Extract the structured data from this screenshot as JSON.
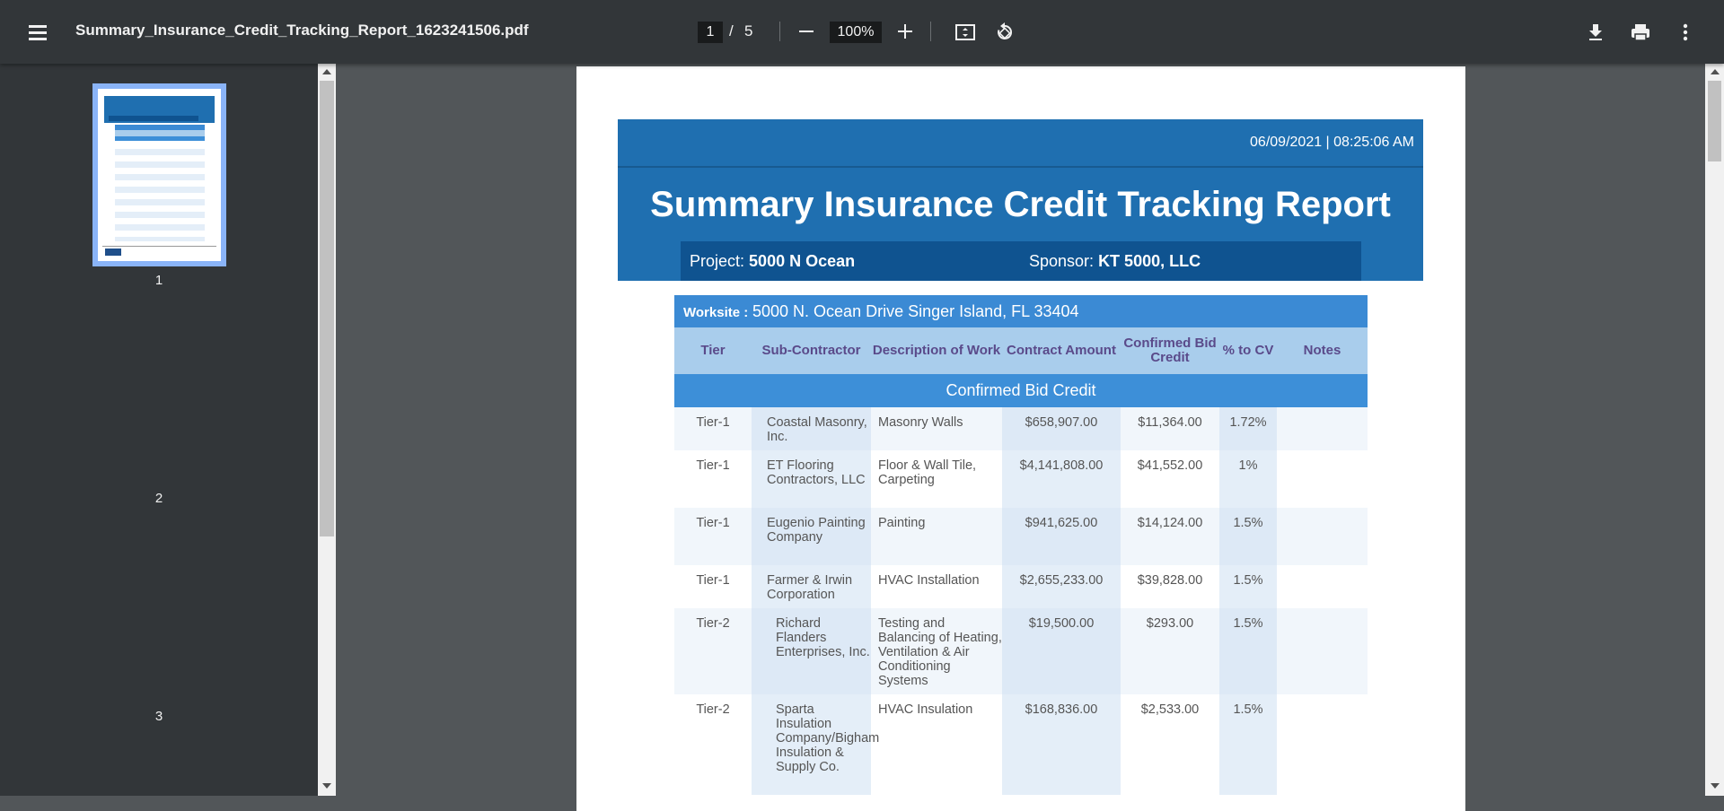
{
  "toolbar": {
    "file_name": "Summary_Insurance_Credit_Tracking_Report_1623241506.pdf",
    "current_page": "1",
    "page_separator": "/",
    "total_pages": "5",
    "zoom": "100%"
  },
  "sidebar": {
    "thumbnails": [
      {
        "label": "1"
      },
      {
        "label": "2"
      },
      {
        "label": "3"
      }
    ]
  },
  "report": {
    "timestamp": "06/09/2021 | 08:25:06 AM",
    "title": "Summary Insurance Credit Tracking Report",
    "project_label": "Project:",
    "project_value": "5000 N Ocean",
    "sponsor_label": "Sponsor:",
    "sponsor_value": "KT 5000, LLC",
    "worksite_label": "Worksite :",
    "worksite_value": "5000 N. Ocean Drive Singer Island, FL 33404",
    "columns": {
      "tier": "Tier",
      "subcontractor": "Sub-Contractor",
      "description": "Description of Work",
      "contract_amount": "Contract Amount",
      "confirmed_bid_credit": "Confirmed Bid Credit",
      "pct_to_cv": "% to CV",
      "notes": "Notes"
    },
    "section_title": "Confirmed Bid Credit",
    "rows": [
      {
        "tier": "Tier-1",
        "subcontractor": "Coastal Masonry, Inc.",
        "description": "Masonry Walls",
        "contract_amount": "$658,907.00",
        "bid_credit": "$11,364.00",
        "pct": "1.72%",
        "notes": ""
      },
      {
        "tier": "Tier-1",
        "subcontractor": "ET Flooring Contractors, LLC",
        "description": "Floor & Wall Tile, Carpeting",
        "contract_amount": "$4,141,808.00",
        "bid_credit": "$41,552.00",
        "pct": "1%",
        "notes": ""
      },
      {
        "tier": "Tier-1",
        "subcontractor": "Eugenio Painting Company",
        "description": "Painting",
        "contract_amount": "$941,625.00",
        "bid_credit": "$14,124.00",
        "pct": "1.5%",
        "notes": ""
      },
      {
        "tier": "Tier-1",
        "subcontractor": "Farmer & Irwin Corporation",
        "description": "HVAC Installation",
        "contract_amount": "$2,655,233.00",
        "bid_credit": "$39,828.00",
        "pct": "1.5%",
        "notes": ""
      },
      {
        "tier": "Tier-2",
        "subcontractor": "Richard Flanders Enterprises, Inc.",
        "description": "Testing and Balancing of Heating, Ventilation & Air Conditioning Systems",
        "contract_amount": "$19,500.00",
        "bid_credit": "$293.00",
        "pct": "1.5%",
        "notes": ""
      },
      {
        "tier": "Tier-2",
        "subcontractor": "Sparta Insulation Company/Bigham Insulation & Supply Co.",
        "description": "HVAC Insulation",
        "contract_amount": "$168,836.00",
        "bid_credit": "$2,533.00",
        "pct": "1.5%",
        "notes": ""
      }
    ]
  }
}
